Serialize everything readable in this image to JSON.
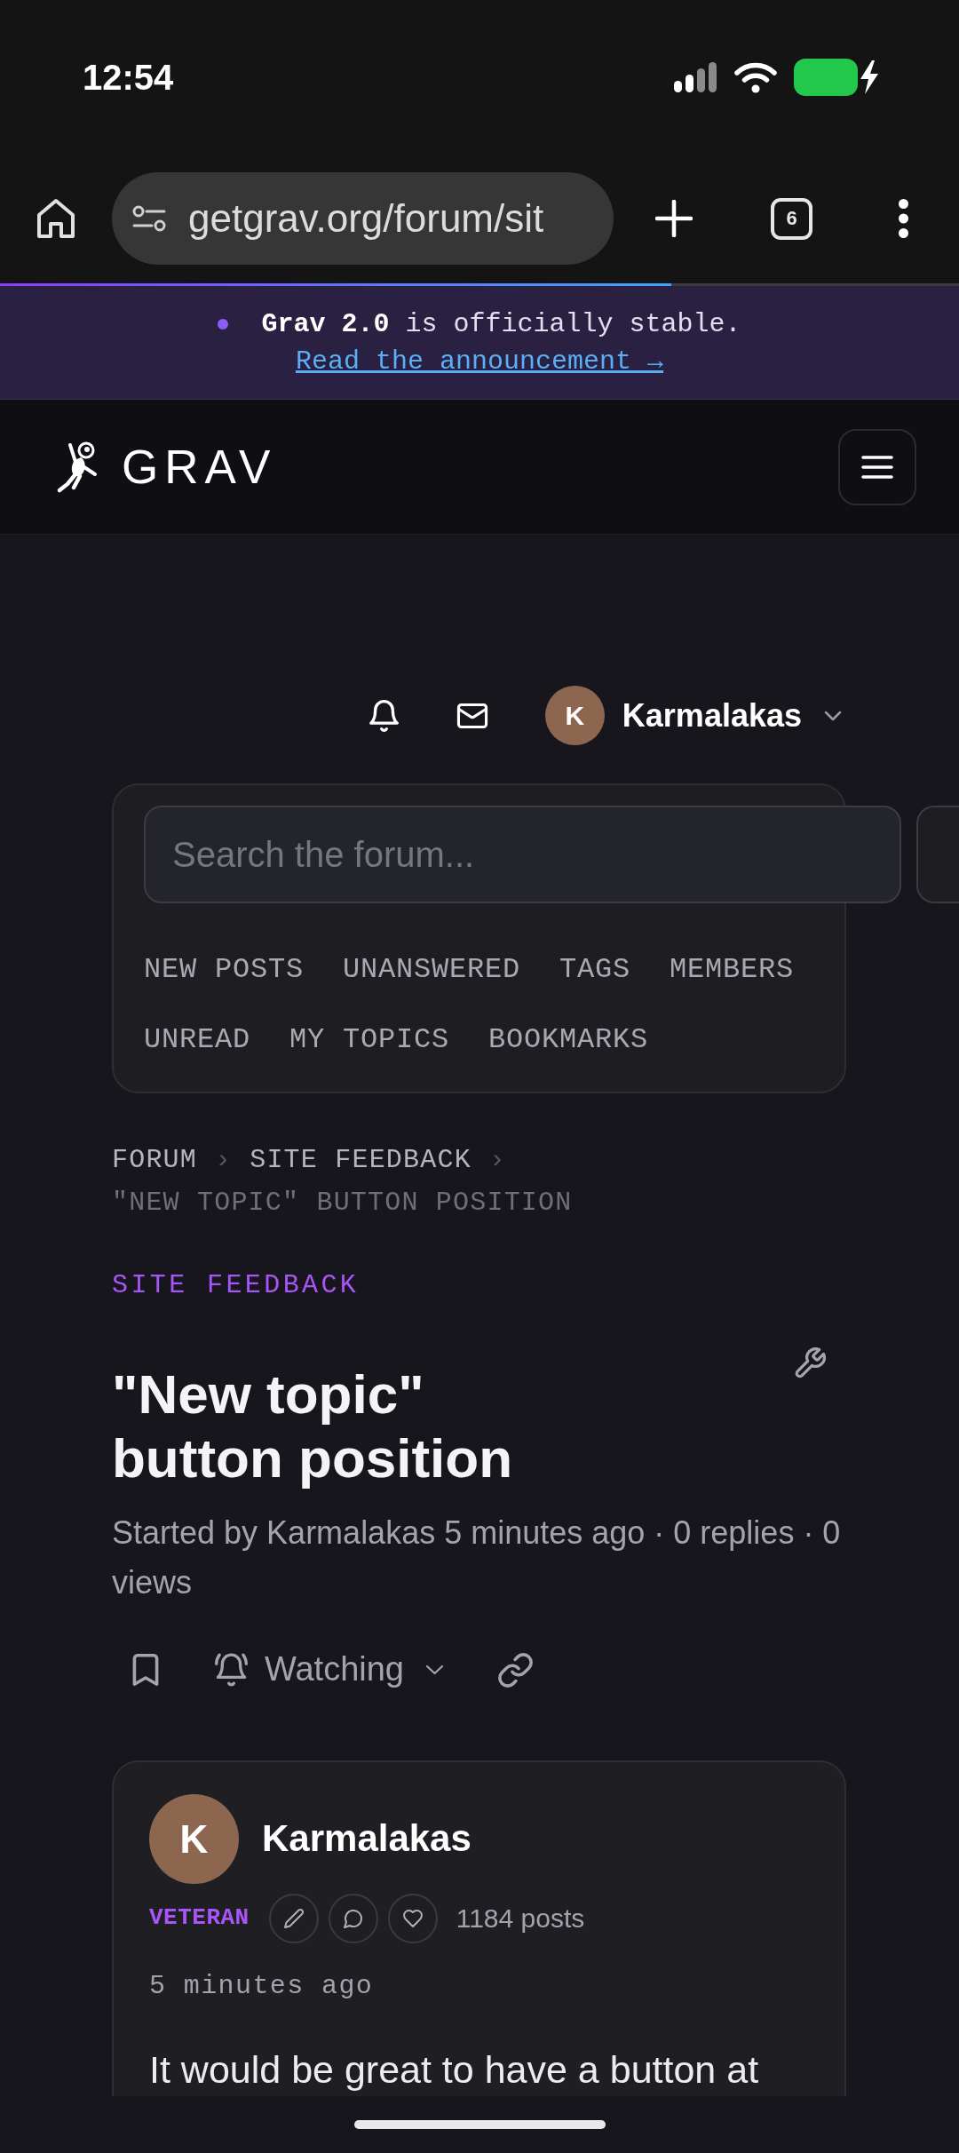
{
  "status_bar": {
    "time": "12:54"
  },
  "browser": {
    "url": "getgrav.org/forum/sit",
    "tab_count": "6",
    "load_progress": {
      "level": 0.7
    }
  },
  "announcement": {
    "text": "**Grav 2.0** is officially stable.",
    "link": "Read the announcement →"
  },
  "site_header": {
    "logo_text": "GRAV"
  },
  "user_menu": {
    "avatar_initial": "K",
    "username": "Karmalakas"
  },
  "search": {
    "placeholder": "Search the forum..."
  },
  "forum_nav": [
    "NEW POSTS",
    "UNANSWERED",
    "TAGS",
    "MEMBERS",
    "UNREAD",
    "MY TOPICS",
    "BOOKMARKS"
  ],
  "breadcrumb": [
    {
      "label": "FORUM",
      "current": false,
      "separator": "›"
    },
    {
      "label": "SITE FEEDBACK",
      "current": false,
      "separator": "›"
    },
    {
      "label": "\"NEW TOPIC\" BUTTON POSITION",
      "current": true
    }
  ],
  "topic": {
    "category": "SITE FEEDBACK",
    "title": "\"New topic\" button position",
    "meta": "Started by Karmalakas 5 minutes ago · 0 replies · 0 views",
    "watch_label": "Watching"
  },
  "post": {
    "avatar_initial": "K",
    "author": "Karmalakas",
    "rank": "VETERAN",
    "post_count": "1184 posts",
    "time": "5 minutes ago",
    "body": "It would be great to have a button at"
  }
}
